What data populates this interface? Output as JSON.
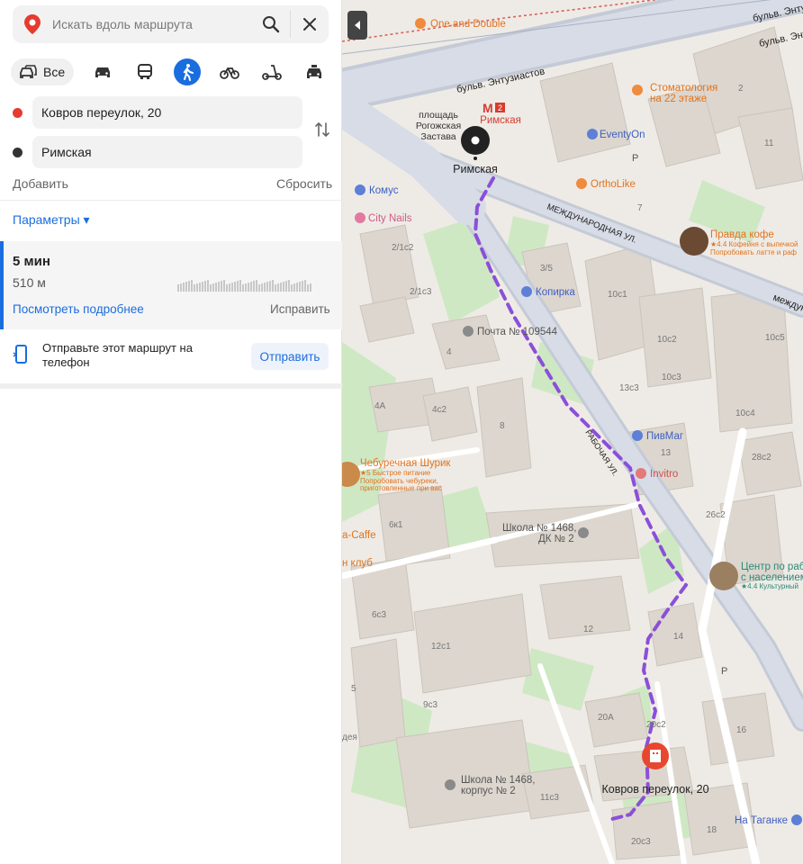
{
  "search": {
    "placeholder": "Искать вдоль маршрута"
  },
  "modes": {
    "all_label": "Все",
    "active": "walk",
    "icons": [
      "car-icon",
      "bus-icon",
      "walk-icon",
      "bicycle-icon",
      "scooter-icon",
      "taxi-icon"
    ]
  },
  "route_points": {
    "from": "Ковров переулок, 20",
    "to": "Римская",
    "from_color": "#e63b2e",
    "to_color": "#333333"
  },
  "actions": {
    "add": "Добавить",
    "reset": "Сбросить",
    "params": "Параметры ▾"
  },
  "route": {
    "time": "5 мин",
    "distance": "510 м",
    "details": "Посмотреть подробнее",
    "fix": "Исправить"
  },
  "send": {
    "text": "Отправьте этот маршрут на телефон",
    "button": "Отправить"
  },
  "colors": {
    "accent": "#1a6dde",
    "route": "#8b4fd9"
  },
  "map": {
    "streets": {
      "entuziastov": "бульв. Энтузиастов",
      "entuz2": "бульв. Энтузиастов",
      "entuz3": "бульв. Энтузиастов",
      "mezhdunarodnaya": "МЕЖДУНАРОДНАЯ УЛ.",
      "mezhdunarodnaya2": "междун",
      "rabochaya": "РАБОЧАЯ УЛ."
    },
    "places": {
      "one_and_double": "One and Double",
      "stomatology1": "Стоматология",
      "stomatology2": "на 22 этаже",
      "eventyon": "EventyOn",
      "ortholike": "OrthoLike",
      "komus": "Комус",
      "city_nails": "City Nails",
      "kopirka": "Копирка",
      "pochta": "Почта № 109544",
      "pivmag": "ПивМаг",
      "invitro": "Invitro",
      "pravda1": "Правда кофе",
      "pravda2": "★4.4 Кофейня с выпечкой",
      "pravda3": "Попробовать латте и раф",
      "cheb1": "Чебуречная Шурик",
      "cheb2": "★5 Быстрое питание",
      "cheb3": "Попробовать чебуреки,",
      "cheb4": "приготовленные при вас",
      "caffe": "a-Caffe",
      "klub": "н клуб",
      "school1_a": "Школа № 1468,",
      "school1_b": "ДК № 2",
      "school2_a": "Школа № 1468,",
      "school2_b": "корпус № 2",
      "center1": "Центр по раб",
      "center2": "с населением",
      "center3": "★4.4 Культурный",
      "na_taganke": "На Таганке",
      "rimskaya_metro": "Римская",
      "rogozhskaya1": "площадь",
      "rogozhskaya2": "Рогожская",
      "rogozhskaya3": "Застава",
      "rimskaya_pin": "Римская",
      "kovrov_pin": "Ковров переулок, 20",
      "deya": "дея"
    },
    "house_numbers": {
      "h2": "2",
      "h11": "11",
      "h7": "7",
      "h21c2": "2/1с2",
      "h21c3": "2/1с3",
      "h35": "3/5",
      "h10c1": "10с1",
      "h10c2": "10с2",
      "h10c5": "10с5",
      "h10c3": "10с3",
      "h10c4": "10с4",
      "h13c3": "13с3",
      "h4": "4",
      "h4a": "4А",
      "h4c2": "4с2",
      "h8": "8",
      "h13": "13",
      "h28c2": "28с2",
      "h26c2": "26с2",
      "h6k1": "6к1",
      "h6c3": "6с3",
      "h12": "12",
      "h12c1": "12с1",
      "h14": "14",
      "h5": "5",
      "h9c3": "9с3",
      "h20a": "20А",
      "h20c2": "20с2",
      "h16": "16",
      "h11c3": "11с3",
      "h18": "18",
      "h20c3": "20с3",
      "p1": "P",
      "p2": "P",
      "metro_line": "2"
    }
  }
}
